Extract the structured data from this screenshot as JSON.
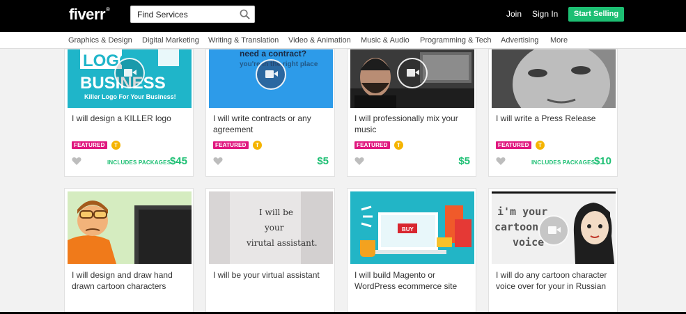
{
  "header": {
    "logo": "fiverr",
    "logo_mark": "®",
    "search_placeholder": "Find Services",
    "join": "Join",
    "sign_in": "Sign In",
    "start_selling": "Start Selling"
  },
  "categories": [
    "Graphics & Design",
    "Digital Marketing",
    "Writing & Translation",
    "Video & Animation",
    "Music & Audio",
    "Programming & Tech",
    "Advertising",
    "More"
  ],
  "gigs_row1": [
    {
      "title": "I will design a KILLER logo",
      "badge": "FEATURED",
      "level": "T",
      "packages": "INCLUDES PACKAGES",
      "price": "$45",
      "thumb_text1": "LOGO",
      "thumb_text2": "BUSINESS",
      "thumb_text3": "Killer Logo For Your Business!"
    },
    {
      "title": "I will write contracts or any agreement",
      "badge": "FEATURED",
      "level": "T",
      "packages": "",
      "price": "$5",
      "thumb_text1": "need a contract?",
      "thumb_text2": "you're in the right place"
    },
    {
      "title": "I will professionally mix your music",
      "badge": "FEATURED",
      "level": "T",
      "packages": "",
      "price": "$5"
    },
    {
      "title": "I will write a Press Release",
      "badge": "FEATURED",
      "level": "T",
      "packages": "INCLUDES PACKAGES",
      "price": "$10"
    }
  ],
  "gigs_row2": [
    {
      "title": "I will design and draw hand drawn cartoon characters"
    },
    {
      "title": "I will be your virtual assistant",
      "thumb_text1": "I will be",
      "thumb_text2": "your",
      "thumb_text3": "virutal assistant."
    },
    {
      "title": "I will build Magento or WordPress ecommerce site",
      "thumb_text1": "BUY"
    },
    {
      "title": "I will do any cartoon character voice over for your in Russian",
      "thumb_text1": "i'm your",
      "thumb_text2": "cartoon",
      "thumb_text3": "voice"
    }
  ],
  "colors": {
    "topbar": "#000000",
    "accent_green": "#1dbf73",
    "featured_pink": "#e0187f",
    "level_gold": "#f5b400"
  }
}
